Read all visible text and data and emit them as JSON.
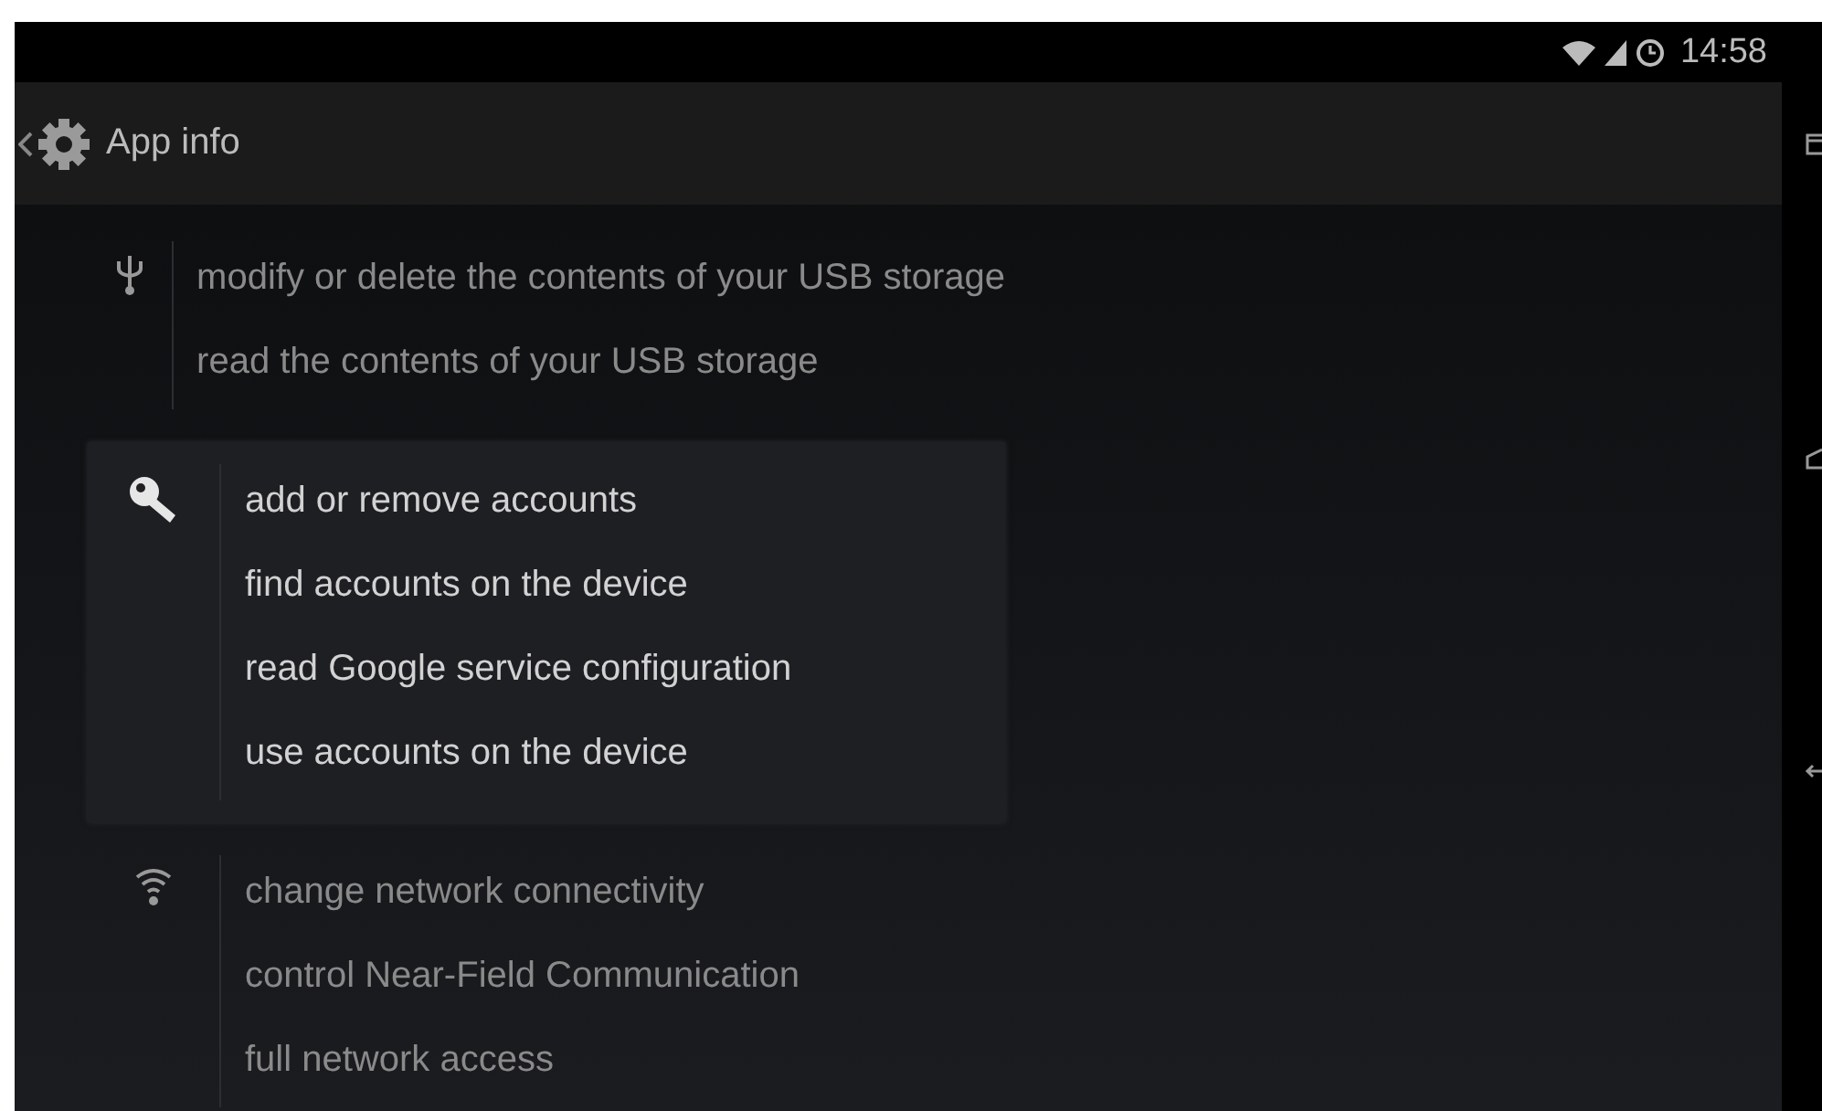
{
  "status_bar": {
    "time": "14:58"
  },
  "action_bar": {
    "title": "App info"
  },
  "permission_groups": [
    {
      "kind": "usb",
      "selected": false,
      "permissions": [
        "modify or delete the contents of your USB storage",
        "read the contents of your USB storage"
      ]
    },
    {
      "kind": "key",
      "selected": true,
      "permissions": [
        "add or remove accounts",
        "find accounts on the device",
        "read Google service configuration",
        "use accounts on the device"
      ]
    },
    {
      "kind": "wifi",
      "selected": false,
      "permissions": [
        "change network connectivity",
        "control Near-Field Communication",
        "full network access"
      ]
    }
  ]
}
